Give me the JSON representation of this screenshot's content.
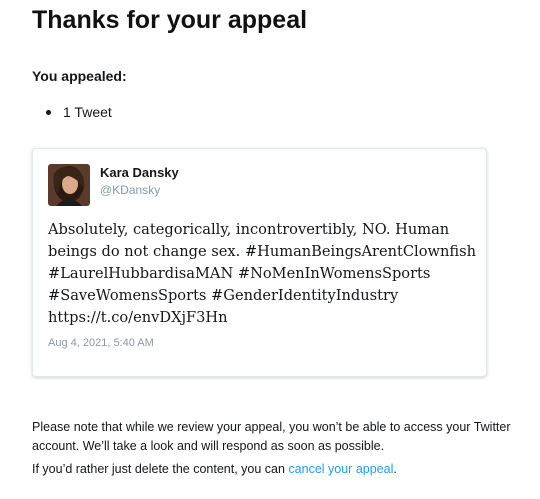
{
  "page": {
    "title": "Thanks for your appeal",
    "subtitle": "You appealed:",
    "bullet": "1 Tweet"
  },
  "tweet": {
    "author_name": "Kara Dansky",
    "author_handle": "@KDansky",
    "text": "Absolutely, categorically, incontrovertibly, NO. Human\nbeings do not change sex. #HumanBeingsArentClownfish\n#LaurelHubbardisaMAN #NoMenInWomensSports\n#SaveWomensSports #GenderIdentityIndustry\nhttps://t.co/envDXjF3Hn",
    "timestamp": "Aug 4, 2021, 5:40 AM"
  },
  "footer": {
    "note": "Please note that while we review your appeal, you won’t be able to access your Twitter account. We’ll take a look and will respond as soon as possible.",
    "cancel_prefix": "If you’d rather just delete the content, you can ",
    "cancel_link": "cancel your appeal",
    "cancel_suffix": "."
  },
  "colors": {
    "link": "#1da1f2",
    "muted": "#8899a6",
    "text": "#14171a"
  }
}
